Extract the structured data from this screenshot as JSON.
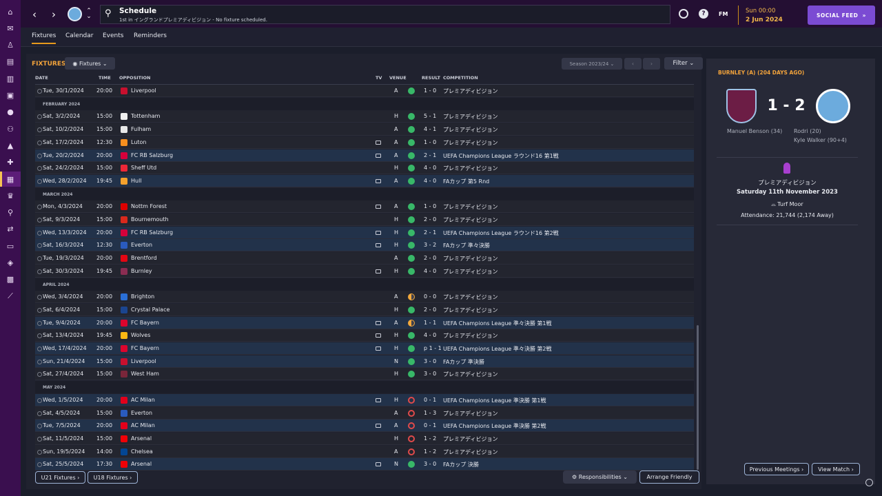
{
  "header": {
    "title": "Schedule",
    "subtitle": "1st in イングランドプレミアディビジョン - No fixture scheduled.",
    "time": "Sun 00:00",
    "date": "2 Jun 2024",
    "social_label": "SOCIAL FEED",
    "fm_label": "FM",
    "back_icon": "chevron-left-icon",
    "forward_icon": "chevron-right-icon"
  },
  "sidebar": {
    "badge": "160",
    "icons": [
      "home-icon",
      "inbox-icon",
      "kit-icon",
      "clipboard-icon",
      "report-icon",
      "dna-icon",
      "ball-icon",
      "people-icon",
      "coach-icon",
      "medical-icon",
      "calendar-icon",
      "trophy-icon",
      "scout-icon",
      "transfer-icon",
      "finance-icon",
      "club-icon",
      "youth-icon",
      "arrow-icon"
    ]
  },
  "tabs": [
    {
      "label": "Fixtures"
    },
    {
      "label": "Calendar"
    },
    {
      "label": "Events"
    },
    {
      "label": "Reminders"
    }
  ],
  "fixtures": {
    "heading": "FIXTURES",
    "view_label": "Fixtures",
    "season": "Season 2023/24",
    "filter": "Filter",
    "columns": {
      "date": "DATE",
      "time": "TIME",
      "opposition": "OPPOSITION",
      "tv": "TV",
      "venue": "VENUE",
      "result": "RESULT",
      "competition": "COMPETITION"
    },
    "rows": [
      {
        "kind": "match",
        "date": "Tue, 30/1/2024",
        "time": "20:00",
        "opp": "Liverpool",
        "crest": "#c8102e",
        "tv": false,
        "venue": "A",
        "result": "1 - 0",
        "outcome": "w",
        "comp": "プレミアディビジョン",
        "hl": false
      },
      {
        "kind": "month",
        "label": "FEBRUARY 2024"
      },
      {
        "kind": "match",
        "date": "Sat, 3/2/2024",
        "time": "15:00",
        "opp": "Tottenham",
        "crest": "#f0f0f0",
        "tv": false,
        "venue": "H",
        "result": "5 - 1",
        "outcome": "w",
        "comp": "プレミアディビジョン",
        "hl": false
      },
      {
        "kind": "match",
        "date": "Sat, 10/2/2024",
        "time": "15:00",
        "opp": "Fulham",
        "crest": "#e8e8e8",
        "tv": false,
        "venue": "A",
        "result": "4 - 1",
        "outcome": "w",
        "comp": "プレミアディビジョン",
        "hl": false
      },
      {
        "kind": "match",
        "date": "Sat, 17/2/2024",
        "time": "12:30",
        "opp": "Luton",
        "crest": "#f78f1e",
        "tv": true,
        "venue": "A",
        "result": "1 - 0",
        "outcome": "w",
        "comp": "プレミアディビジョン",
        "hl": false
      },
      {
        "kind": "match",
        "date": "Tue, 20/2/2024",
        "time": "20:00",
        "opp": "FC RB Salzburg",
        "crest": "#d6003b",
        "tv": true,
        "venue": "A",
        "result": "2 - 1",
        "outcome": "w",
        "comp": "UEFA Champions League ラウンド16 第1戦",
        "hl": true
      },
      {
        "kind": "match",
        "date": "Sat, 24/2/2024",
        "time": "15:00",
        "opp": "Sheff Utd",
        "crest": "#ee2737",
        "tv": false,
        "venue": "H",
        "result": "4 - 0",
        "outcome": "w",
        "comp": "プレミアディビジョン",
        "hl": false
      },
      {
        "kind": "match",
        "date": "Wed, 28/2/2024",
        "time": "19:45",
        "opp": "Hull",
        "crest": "#f5a12c",
        "tv": true,
        "venue": "A",
        "result": "4 - 0",
        "outcome": "w",
        "comp": "FAカップ 第5 Rnd",
        "hl": true
      },
      {
        "kind": "month",
        "label": "MARCH 2024"
      },
      {
        "kind": "match",
        "date": "Mon, 4/3/2024",
        "time": "20:00",
        "opp": "Nottm Forest",
        "crest": "#dd0000",
        "tv": true,
        "venue": "A",
        "result": "1 - 0",
        "outcome": "w",
        "comp": "プレミアディビジョン",
        "hl": false
      },
      {
        "kind": "match",
        "date": "Sat, 9/3/2024",
        "time": "15:00",
        "opp": "Bournemouth",
        "crest": "#da291c",
        "tv": false,
        "venue": "H",
        "result": "2 - 0",
        "outcome": "w",
        "comp": "プレミアディビジョン",
        "hl": false
      },
      {
        "kind": "match",
        "date": "Wed, 13/3/2024",
        "time": "20:00",
        "opp": "FC RB Salzburg",
        "crest": "#d6003b",
        "tv": true,
        "venue": "H",
        "result": "2 - 1",
        "outcome": "w",
        "comp": "UEFA Champions League ラウンド16 第2戦",
        "hl": true
      },
      {
        "kind": "match",
        "date": "Sat, 16/3/2024",
        "time": "12:30",
        "opp": "Everton",
        "crest": "#2a5bbf",
        "tv": true,
        "venue": "H",
        "result": "3 - 2",
        "outcome": "w",
        "comp": "FAカップ 準々決勝",
        "hl": true
      },
      {
        "kind": "match",
        "date": "Tue, 19/3/2024",
        "time": "20:00",
        "opp": "Brentford",
        "crest": "#e30613",
        "tv": false,
        "venue": "A",
        "result": "2 - 0",
        "outcome": "w",
        "comp": "プレミアディビジョン",
        "hl": false
      },
      {
        "kind": "match",
        "date": "Sat, 30/3/2024",
        "time": "19:45",
        "opp": "Burnley",
        "crest": "#8a2d52",
        "tv": true,
        "venue": "H",
        "result": "4 - 0",
        "outcome": "w",
        "comp": "プレミアディビジョン",
        "hl": false
      },
      {
        "kind": "month",
        "label": "APRIL 2024"
      },
      {
        "kind": "match",
        "date": "Wed, 3/4/2024",
        "time": "20:00",
        "opp": "Brighton",
        "crest": "#2a6fd6",
        "tv": false,
        "venue": "A",
        "result": "0 - 0",
        "outcome": "d",
        "comp": "プレミアディビジョン",
        "hl": false
      },
      {
        "kind": "match",
        "date": "Sat, 6/4/2024",
        "time": "15:00",
        "opp": "Crystal Palace",
        "crest": "#1b458f",
        "tv": false,
        "venue": "H",
        "result": "2 - 0",
        "outcome": "w",
        "comp": "プレミアディビジョン",
        "hl": false
      },
      {
        "kind": "match",
        "date": "Tue, 9/4/2024",
        "time": "20:00",
        "opp": "FC Bayern",
        "crest": "#dc052d",
        "tv": true,
        "venue": "A",
        "result": "1 - 1",
        "outcome": "d",
        "comp": "UEFA Champions League 準々決勝 第1戦",
        "hl": true
      },
      {
        "kind": "match",
        "date": "Sat, 13/4/2024",
        "time": "19:45",
        "opp": "Wolves",
        "crest": "#fdb913",
        "tv": true,
        "venue": "H",
        "result": "4 - 0",
        "outcome": "w",
        "comp": "プレミアディビジョン",
        "hl": false
      },
      {
        "kind": "match",
        "date": "Wed, 17/4/2024",
        "time": "20:00",
        "opp": "FC Bayern",
        "crest": "#dc052d",
        "tv": true,
        "venue": "H",
        "result": "p 1 - 1",
        "outcome": "w",
        "comp": "UEFA Champions League 準々決勝 第2戦",
        "hl": true
      },
      {
        "kind": "match",
        "date": "Sun, 21/4/2024",
        "time": "15:00",
        "opp": "Liverpool",
        "crest": "#c8102e",
        "tv": false,
        "venue": "N",
        "result": "3 - 0",
        "outcome": "w",
        "comp": "FAカップ 準決勝",
        "hl": true
      },
      {
        "kind": "match",
        "date": "Sat, 27/4/2024",
        "time": "15:00",
        "opp": "West Ham",
        "crest": "#7a263a",
        "tv": false,
        "venue": "H",
        "result": "3 - 0",
        "outcome": "w",
        "comp": "プレミアディビジョン",
        "hl": false
      },
      {
        "kind": "month",
        "label": "MAY 2024"
      },
      {
        "kind": "match",
        "date": "Wed, 1/5/2024",
        "time": "20:00",
        "opp": "AC Milan",
        "crest": "#e3001b",
        "tv": true,
        "venue": "H",
        "result": "0 - 1",
        "outcome": "l",
        "comp": "UEFA Champions League 準決勝 第1戦",
        "hl": true
      },
      {
        "kind": "match",
        "date": "Sat, 4/5/2024",
        "time": "15:00",
        "opp": "Everton",
        "crest": "#2a5bbf",
        "tv": false,
        "venue": "A",
        "result": "1 - 3",
        "outcome": "l",
        "comp": "プレミアディビジョン",
        "hl": false
      },
      {
        "kind": "match",
        "date": "Tue, 7/5/2024",
        "time": "20:00",
        "opp": "AC Milan",
        "crest": "#e3001b",
        "tv": true,
        "venue": "A",
        "result": "0 - 1",
        "outcome": "l",
        "comp": "UEFA Champions League 準決勝 第2戦",
        "hl": true
      },
      {
        "kind": "match",
        "date": "Sat, 11/5/2024",
        "time": "15:00",
        "opp": "Arsenal",
        "crest": "#ef0107",
        "tv": false,
        "venue": "H",
        "result": "1 - 2",
        "outcome": "l",
        "comp": "プレミアディビジョン",
        "hl": false
      },
      {
        "kind": "match",
        "date": "Sun, 19/5/2024",
        "time": "14:00",
        "opp": "Chelsea",
        "crest": "#034694",
        "tv": false,
        "venue": "A",
        "result": "1 - 2",
        "outcome": "l",
        "comp": "プレミアディビジョン",
        "hl": false
      },
      {
        "kind": "match",
        "date": "Sat, 25/5/2024",
        "time": "17:30",
        "opp": "Arsenal",
        "crest": "#ef0107",
        "tv": true,
        "venue": "N",
        "result": "3 - 0",
        "outcome": "w",
        "comp": "FAカップ 決勝",
        "hl": true
      }
    ],
    "buttons": {
      "u21": "U21 Fixtures",
      "u18": "U18 Fixtures",
      "responsibilities": "Responsibilities",
      "arrange": "Arrange Friendly"
    }
  },
  "match_panel": {
    "title": "BURNLEY (A) (204 DAYS AGO)",
    "score": "1 - 2",
    "home_scorers": [
      "Manuel Benson (34)"
    ],
    "away_scorers": [
      "Rodri (20)",
      "Kyle Walker (90+4)"
    ],
    "competition": "プレミアディビジョン",
    "date": "Saturday 11th November 2023",
    "venue": "Turf Moor",
    "attendance": "Attendance: 21,744 (2,174 Away)",
    "prev_label": "Previous Meetings",
    "view_label": "View Match"
  }
}
